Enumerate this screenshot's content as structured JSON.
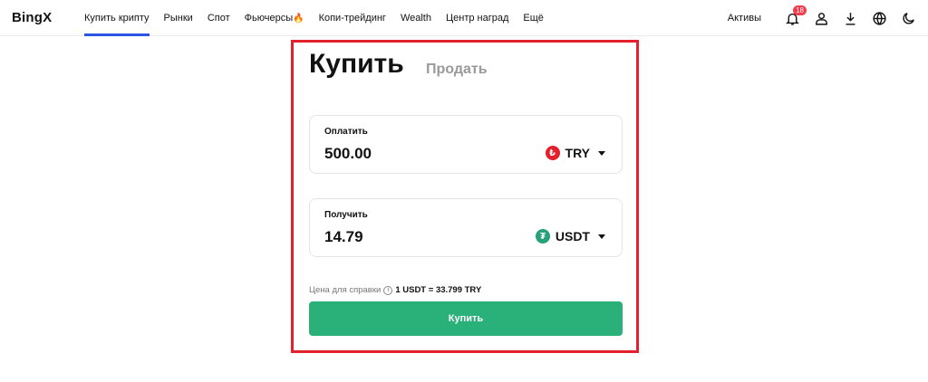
{
  "header": {
    "logo": "BingX",
    "nav": [
      {
        "label": "Купить крипту",
        "active": true
      },
      {
        "label": "Рынки"
      },
      {
        "label": "Спот"
      },
      {
        "label": "Фьючерсы"
      },
      {
        "label": "Копи-трейдинг"
      },
      {
        "label": "Wealth"
      },
      {
        "label": "Центр наград"
      },
      {
        "label": "Ещё"
      }
    ],
    "assets_label": "Активы",
    "notifications_count": "18",
    "icons": [
      "bell-icon",
      "user-icon",
      "download-icon",
      "globe-icon",
      "moon-icon"
    ]
  },
  "trade": {
    "buy_tab": "Купить",
    "sell_tab": "Продать",
    "pay": {
      "label": "Оплатить",
      "amount": "500.00",
      "currency": "TRY",
      "coin_symbol": "₺"
    },
    "receive": {
      "label": "Получить",
      "amount": "14.79",
      "currency": "USDT",
      "coin_symbol": "₮"
    },
    "reference_label": "Цена для справки",
    "rate": "1 USDT = 33.799 TRY",
    "buy_button": "Купить"
  },
  "colors": {
    "accent_blue": "#2a55e5",
    "buy_green": "#2ab17a",
    "frame_red": "#e3202b",
    "usdt_green": "#26a17b",
    "badge_red": "#f23a4a"
  }
}
